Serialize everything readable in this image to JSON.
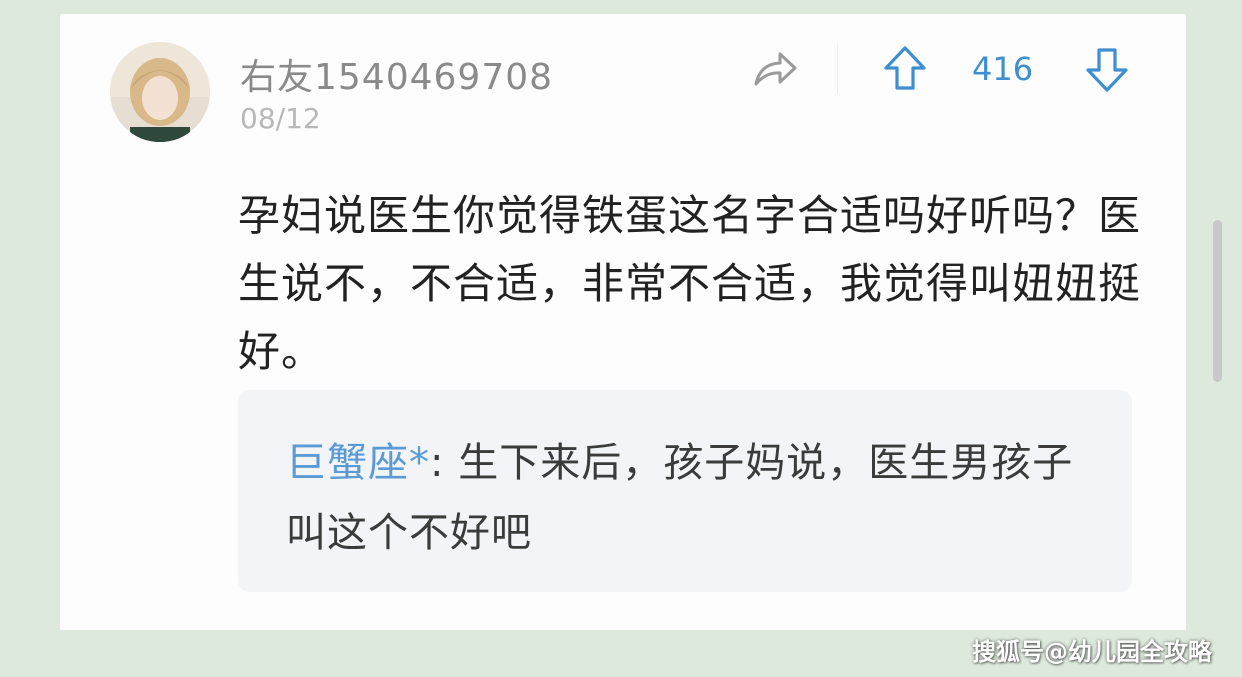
{
  "post": {
    "username": "右友1540469708",
    "date": "08/12",
    "vote_count": "416",
    "body": "孕妇说医生你觉得铁蛋这名字合适吗好听吗？医生说不，不合适，非常不合适，我觉得叫妞妞挺好。"
  },
  "reply": {
    "author": "巨蟹座*",
    "separator": ": ",
    "text": "生下来后，孩子妈说，医生男孩子叫这个不好吧"
  },
  "watermark": "搜狐号@幼儿园全攻略",
  "icons": {
    "share": "share-icon",
    "upvote": "arrow-up-icon",
    "downvote": "arrow-down-icon"
  },
  "colors": {
    "background": "#dde9dc",
    "card": "#fdfdfd",
    "accent_blue": "#3d8fd1",
    "reply_author": "#5b9bd5",
    "reply_bg": "#f3f4f7"
  }
}
